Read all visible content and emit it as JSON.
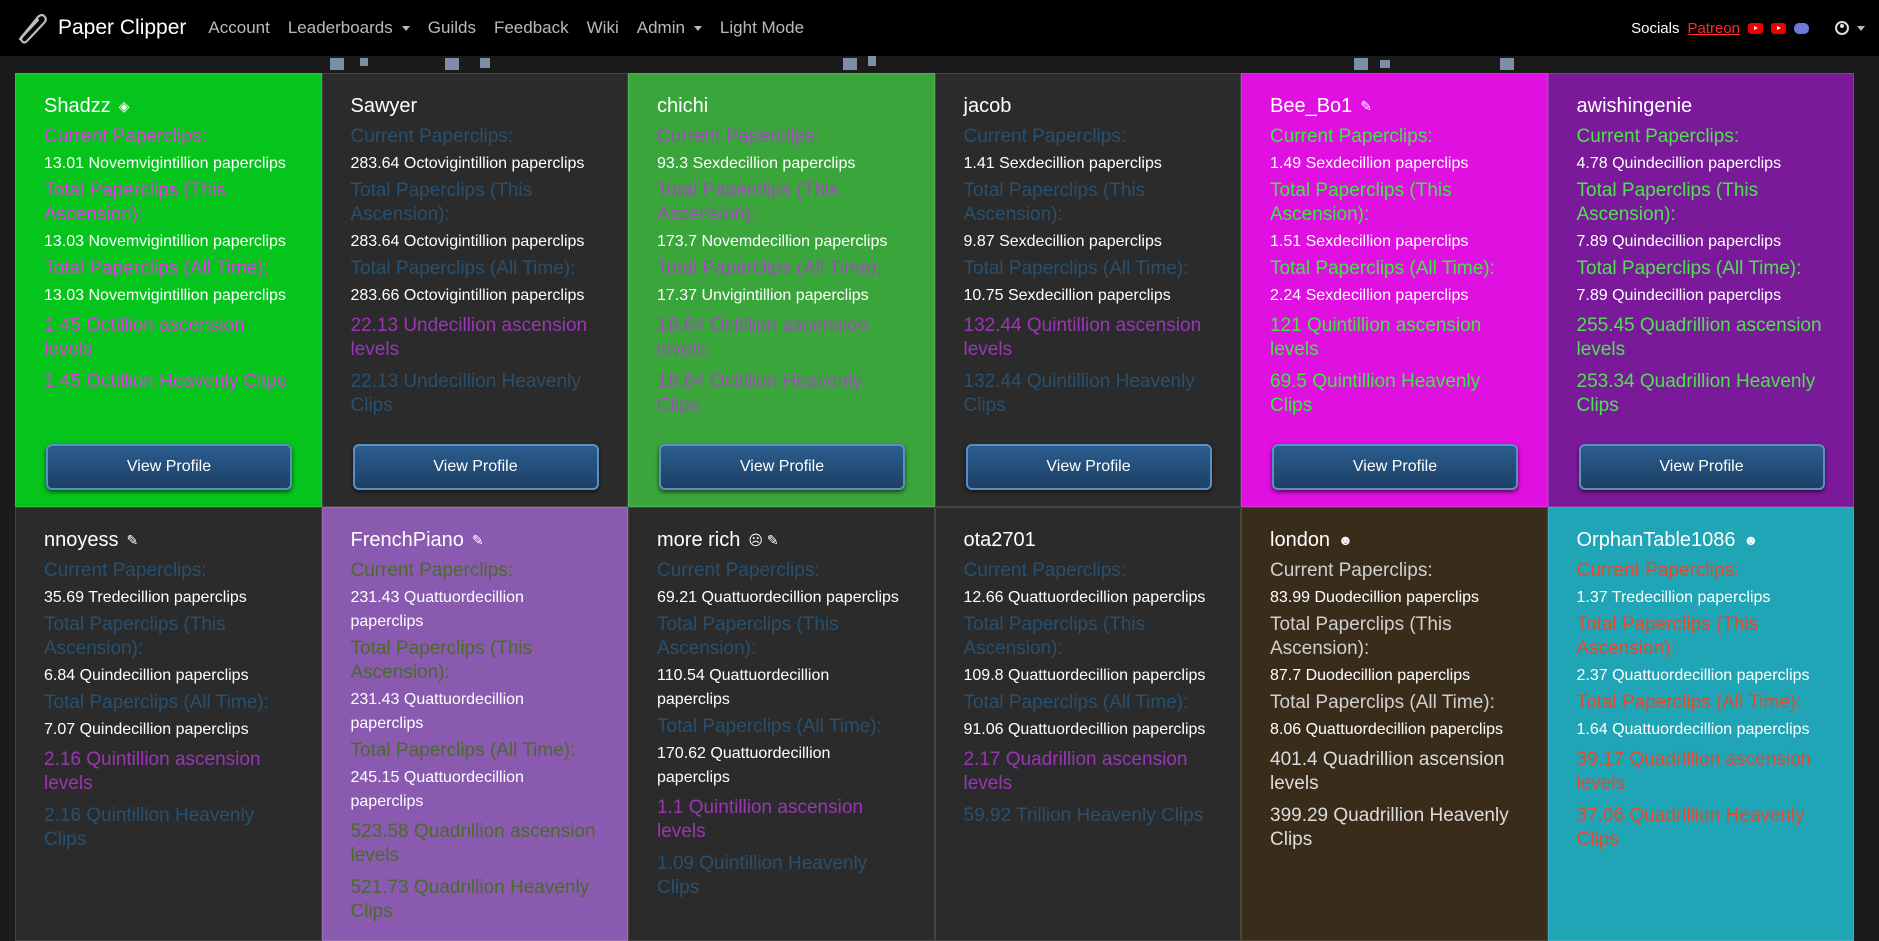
{
  "nav": {
    "brand": "Paper Clipper",
    "items": [
      {
        "label": "Account",
        "dropdown": false
      },
      {
        "label": "Leaderboards",
        "dropdown": true
      },
      {
        "label": "Guilds",
        "dropdown": false
      },
      {
        "label": "Feedback",
        "dropdown": false
      },
      {
        "label": "Wiki",
        "dropdown": false
      },
      {
        "label": "Admin",
        "dropdown": true
      },
      {
        "label": "Light Mode",
        "dropdown": false
      }
    ],
    "socials_label": "Socials",
    "patreon": "Patreon"
  },
  "labels": {
    "current": "Current Paperclips:",
    "total_ascension": "Total Paperclips (This Ascension):",
    "total_all": "Total Paperclips (All Time):",
    "view_profile": "View Profile"
  },
  "cards": [
    {
      "name": "Shadzz",
      "badge": "◈",
      "bg": "#05c41c",
      "label_color": "#e23be6",
      "big_color": "#e23be6",
      "current": "13.01 Novemvigintillion paperclips",
      "total_asc": "13.03 Novemvigintillion paperclips",
      "total_all": "13.03 Novemvigintillion paperclips",
      "asc_levels": "1.45 Octillion ascension levels",
      "heavenly": "1.45 Octillion Heavenly Clips",
      "button": true
    },
    {
      "name": "Sawyer",
      "badge": "",
      "bg": "#2b2b2b",
      "label_color": "#28506e",
      "big_color": "#9a35b6",
      "current": "283.64 Octovigintillion paperclips",
      "total_asc": "283.64 Octovigintillion paperclips",
      "total_all": "283.66 Octovigintillion paperclips",
      "asc_levels": "22.13 Undecillion ascension levels",
      "heavenly": "22.13 Undecillion Heavenly Clips",
      "button": true
    },
    {
      "name": "chichi",
      "badge": "",
      "bg": "#3aa53a",
      "label_color": "#a34cc0",
      "big_color": "#a34cc0",
      "current": "93.3 Sexdecillion paperclips",
      "total_asc": "173.7 Novemdecillion paperclips",
      "total_all": "17.37 Unvigintillion paperclips",
      "asc_levels": "18.64 Octillion ascension levels",
      "heavenly": "18.64 Octillion Heavenly Clips",
      "button": true
    },
    {
      "name": "jacob",
      "badge": "",
      "bg": "#2b2b2b",
      "label_color": "#28506e",
      "big_color": "#9a35b6",
      "current": "1.41 Sexdecillion paperclips",
      "total_asc": "9.87 Sexdecillion paperclips",
      "total_all": "10.75 Sexdecillion paperclips",
      "asc_levels": "132.44 Quintillion ascension levels",
      "heavenly": "132.44 Quintillion Heavenly Clips",
      "button": true
    },
    {
      "name": "Bee_Bo1",
      "badge": "✎",
      "bg": "#e010e0",
      "label_color": "#3ee83e",
      "big_color": "#3ee83e",
      "current": "1.49 Sexdecillion paperclips",
      "total_asc": "1.51 Sexdecillion paperclips",
      "total_all": "2.24 Sexdecillion paperclips",
      "asc_levels": "121 Quintillion ascension levels",
      "heavenly": "69.5 Quintillion Heavenly Clips",
      "button": true
    },
    {
      "name": "awishingenie",
      "badge": "",
      "bg": "#7a1a9a",
      "label_color": "#4ee04e",
      "big_color": "#4ee04e",
      "current": "4.78 Quindecillion paperclips",
      "total_asc": "7.89 Quindecillion paperclips",
      "total_all": "7.89 Quindecillion paperclips",
      "asc_levels": "255.45 Quadrillion ascension levels",
      "heavenly": "253.34 Quadrillion Heavenly Clips",
      "button": true
    },
    {
      "name": "nnoyess",
      "badge": "✎",
      "bg": "#2b2b2b",
      "label_color": "#28506e",
      "big_color": "#9a35b6",
      "current": "35.69 Tredecillion paperclips",
      "total_asc": "6.84 Quindecillion paperclips",
      "total_all": "7.07 Quindecillion paperclips",
      "asc_levels": "2.16 Quintillion ascension levels",
      "heavenly": "2.16 Quintillion Heavenly Clips",
      "button": false
    },
    {
      "name": "FrenchPiano",
      "badge": "✎",
      "bg": "#8a5ab0",
      "label_color": "#4a6a2a",
      "big_color": "#4a6a2a",
      "current": "231.43 Quattuordecillion paperclips",
      "total_asc": "231.43 Quattuordecillion paperclips",
      "total_all": "245.15 Quattuordecillion paperclips",
      "asc_levels": "523.58 Quadrillion ascension levels",
      "heavenly": "521.73 Quadrillion Heavenly Clips",
      "button": false
    },
    {
      "name": "more rich",
      "badge": "☹ ✎",
      "bg": "#2b2b2b",
      "label_color": "#28506e",
      "big_color": "#9a35b6",
      "current": "69.21 Quattuordecillion paperclips",
      "total_asc": "110.54 Quattuordecillion paperclips",
      "total_all": "170.62 Quattuordecillion paperclips",
      "asc_levels": "1.1 Quintillion ascension levels",
      "heavenly": "1.09 Quintillion Heavenly Clips",
      "button": false
    },
    {
      "name": "ota2701",
      "badge": "",
      "bg": "#2b2b2b",
      "label_color": "#28506e",
      "big_color": "#9a35b6",
      "current": "12.66 Quattuordecillion paperclips",
      "total_asc": "109.8 Quattuordecillion paperclips",
      "total_all": "91.06 Quattuordecillion paperclips",
      "asc_levels": "2.17 Quadrillion ascension levels",
      "heavenly": "59.92 Trillion Heavenly Clips",
      "button": false
    },
    {
      "name": "london",
      "badge": "☻",
      "bg": "#3a2c1a",
      "label_color": "#cfcfcf",
      "big_color": "#dcdcdc",
      "current": "83.99 Duodecillion paperclips",
      "total_asc": "87.7 Duodecillion paperclips",
      "total_all": "8.06 Quattuordecillion paperclips",
      "asc_levels": "401.4 Quadrillion ascension levels",
      "heavenly": "399.29 Quadrillion Heavenly Clips",
      "button": false
    },
    {
      "name": "OrphanTable1086",
      "badge": "☻",
      "bg": "#1fa5b5",
      "label_color": "#e64a2a",
      "big_color": "#e64a2a",
      "current": "1.37 Tredecillion paperclips",
      "total_asc": "2.37 Quattuordecillion paperclips",
      "total_all": "1.64 Quattuordecillion paperclips",
      "asc_levels": "39.17 Quadrillion ascension levels",
      "heavenly": "37.06 Quadrillion Heavenly Clips",
      "button": false
    }
  ]
}
